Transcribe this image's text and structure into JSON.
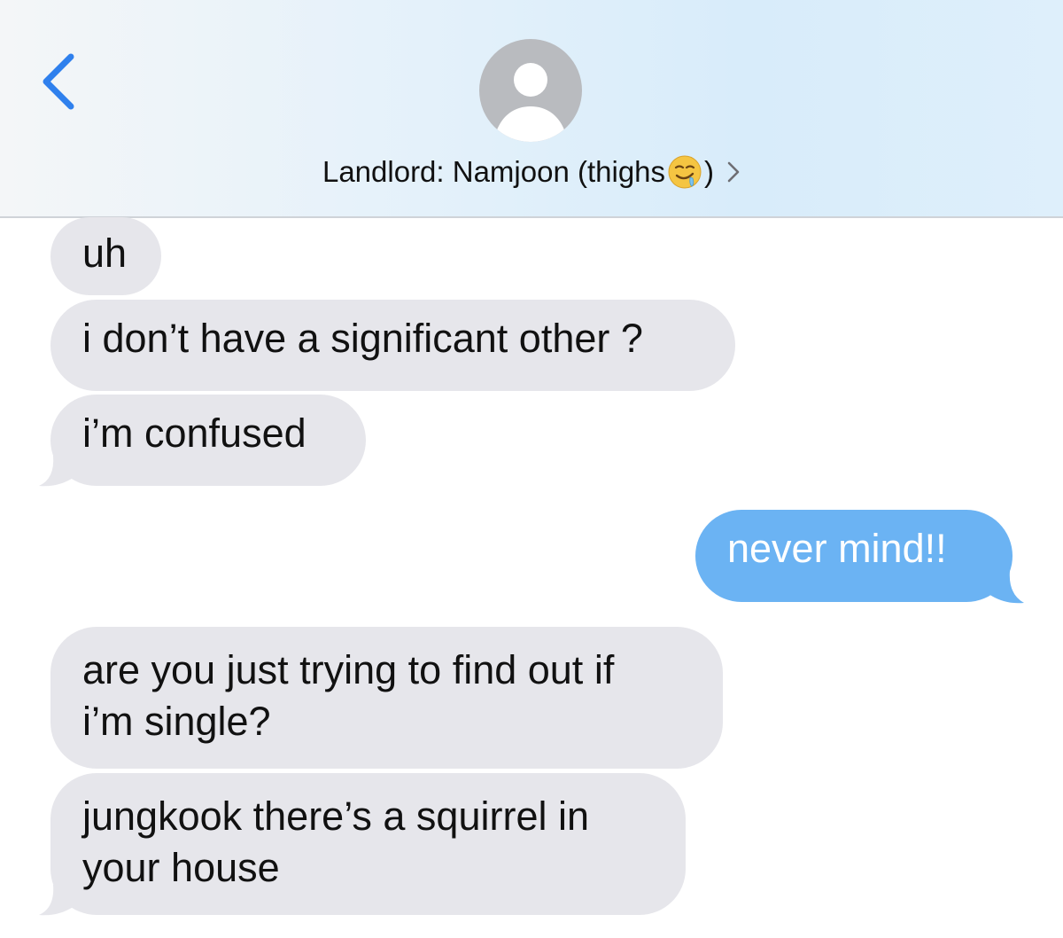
{
  "header": {
    "contact_name": "Landlord: Namjoon (thighs",
    "contact_suffix": ")",
    "emoji": "drooling-face-emoji",
    "icons": {
      "back": "chevron-left-icon",
      "avatar": "person-silhouette-icon",
      "details": "chevron-right-icon"
    }
  },
  "messages": [
    {
      "direction": "incoming",
      "lines": [
        "uh"
      ]
    },
    {
      "direction": "incoming",
      "lines": [
        "i don’t have a significant other ?"
      ]
    },
    {
      "direction": "incoming",
      "lines": [
        "i’m confused"
      ]
    },
    {
      "direction": "outgoing",
      "lines": [
        "never mind!!"
      ]
    },
    {
      "direction": "incoming",
      "lines": [
        "are you just trying to find out if",
        "i’m single?"
      ]
    },
    {
      "direction": "incoming",
      "lines": [
        "jungkook there’s a squirrel in",
        "your house"
      ]
    }
  ],
  "colors": {
    "incoming_bubble": "#e6e6eb",
    "outgoing_bubble": "#6bb3f3",
    "accent": "#2f80ed"
  }
}
